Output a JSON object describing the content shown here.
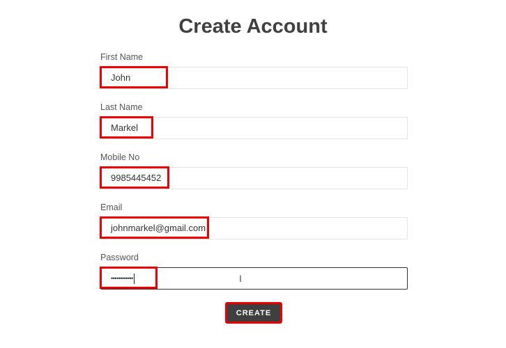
{
  "page": {
    "title": "Create Account"
  },
  "form": {
    "fields": [
      {
        "label": "First Name",
        "value": "John",
        "type": "text"
      },
      {
        "label": "Last Name",
        "value": "Markel",
        "type": "text"
      },
      {
        "label": "Mobile No",
        "value": "9985445452",
        "type": "text"
      },
      {
        "label": "Email",
        "value": "johnmarkel@gmail.com",
        "type": "email"
      },
      {
        "label": "Password",
        "value": "••••••••••••",
        "type": "password",
        "focused": true
      }
    ],
    "submit_label": "CREATE"
  },
  "annotations": {
    "highlight_color": "#ee0000"
  }
}
